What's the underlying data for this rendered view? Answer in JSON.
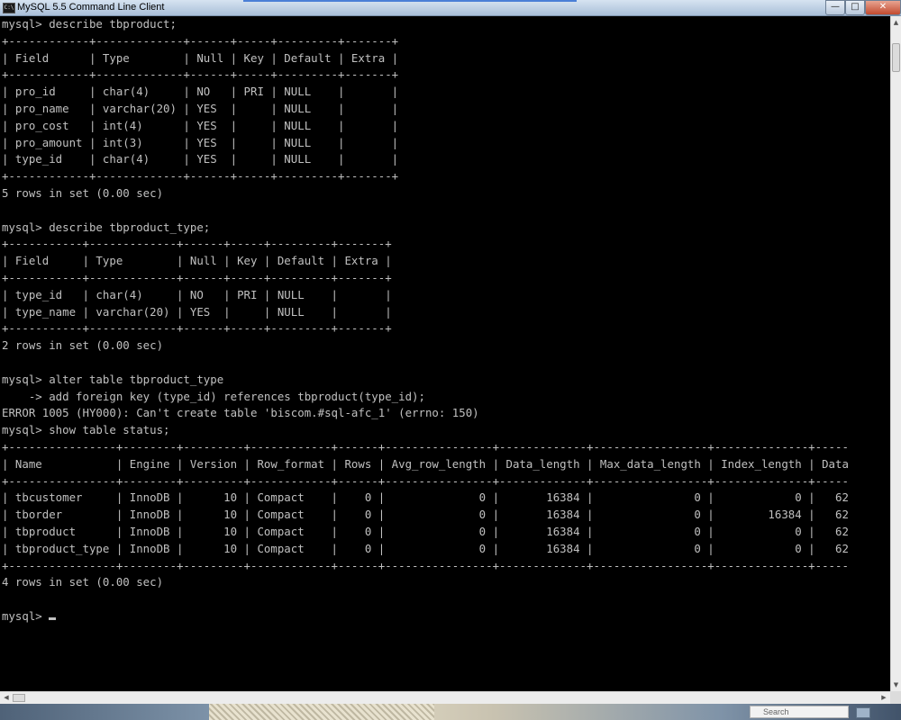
{
  "window": {
    "title": "MySQL 5.5 Command Line Client",
    "icon_text": "C:\\",
    "controls": {
      "minimize": "—",
      "maximize": "□",
      "close": "✕"
    }
  },
  "console": {
    "lines": [
      "mysql> describe tbproduct;",
      "+------------+-------------+------+-----+---------+-------+",
      "| Field      | Type        | Null | Key | Default | Extra |",
      "+------------+-------------+------+-----+---------+-------+",
      "| pro_id     | char(4)     | NO   | PRI | NULL    |       |",
      "| pro_name   | varchar(20) | YES  |     | NULL    |       |",
      "| pro_cost   | int(4)      | YES  |     | NULL    |       |",
      "| pro_amount | int(3)      | YES  |     | NULL    |       |",
      "| type_id    | char(4)     | YES  |     | NULL    |       |",
      "+------------+-------------+------+-----+---------+-------+",
      "5 rows in set (0.00 sec)",
      "",
      "mysql> describe tbproduct_type;",
      "+-----------+-------------+------+-----+---------+-------+",
      "| Field     | Type        | Null | Key | Default | Extra |",
      "+-----------+-------------+------+-----+---------+-------+",
      "| type_id   | char(4)     | NO   | PRI | NULL    |       |",
      "| type_name | varchar(20) | YES  |     | NULL    |       |",
      "+-----------+-------------+------+-----+---------+-------+",
      "2 rows in set (0.00 sec)",
      "",
      "mysql> alter table tbproduct_type",
      "    -> add foreign key (type_id) references tbproduct(type_id);",
      "ERROR 1005 (HY000): Can't create table 'biscom.#sql-afc_1' (errno: 150)",
      "mysql> show table status;",
      "+----------------+--------+---------+------------+------+----------------+-------------+-----------------+--------------+-----",
      "| Name           | Engine | Version | Row_format | Rows | Avg_row_length | Data_length | Max_data_length | Index_length | Data",
      "+----------------+--------+---------+------------+------+----------------+-------------+-----------------+--------------+-----",
      "| tbcustomer     | InnoDB |      10 | Compact    |    0 |              0 |       16384 |               0 |            0 |   62",
      "| tborder        | InnoDB |      10 | Compact    |    0 |              0 |       16384 |               0 |        16384 |   62",
      "| tbproduct      | InnoDB |      10 | Compact    |    0 |              0 |       16384 |               0 |            0 |   62",
      "| tbproduct_type | InnoDB |      10 | Compact    |    0 |              0 |       16384 |               0 |            0 |   62",
      "+----------------+--------+---------+------------+------+----------------+-------------+-----------------+--------------+-----",
      "4 rows in set (0.00 sec)",
      "",
      "mysql> "
    ]
  },
  "scrollbars": {
    "up_arrow": "▲",
    "down_arrow": "▼",
    "left_arrow": "◀",
    "right_arrow": "▶"
  },
  "desktop": {
    "search_text": "Search"
  }
}
